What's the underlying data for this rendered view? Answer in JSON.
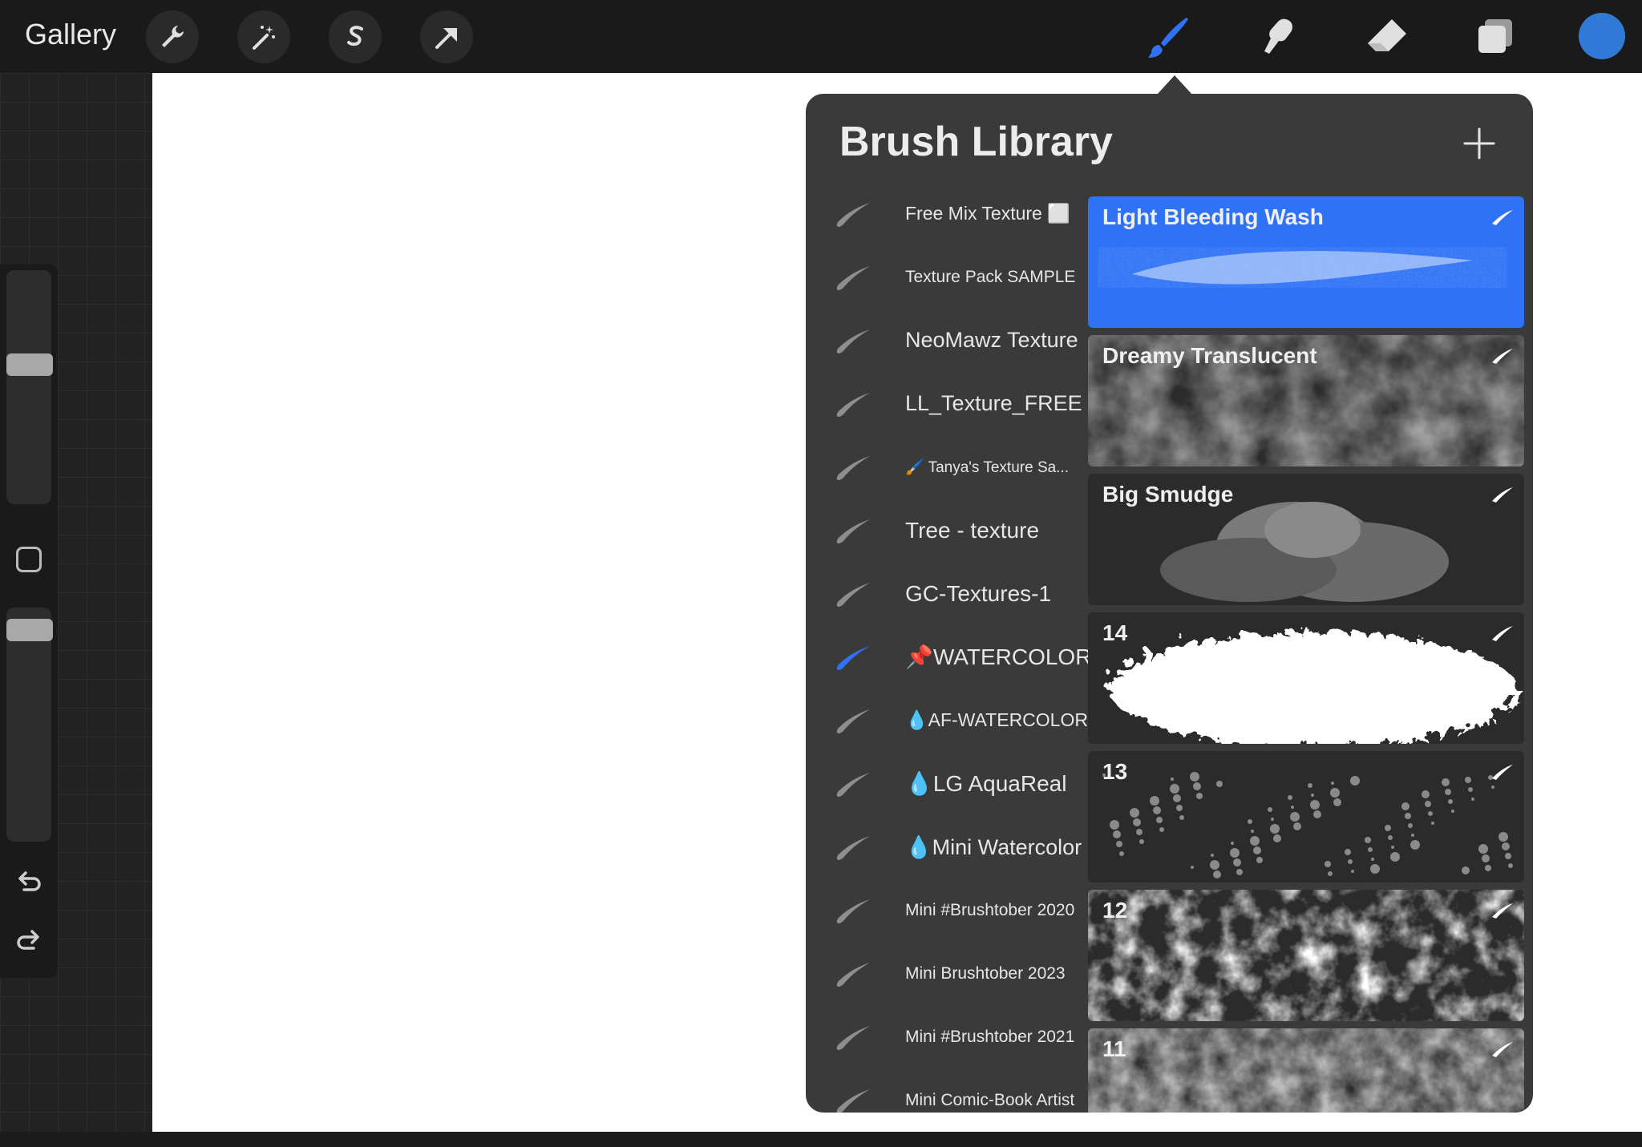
{
  "topbar": {
    "gallery_label": "Gallery",
    "left_tools": [
      "wrench-icon",
      "magic-wand-icon",
      "selection-s-icon",
      "transform-arrow-icon"
    ],
    "right_tools": [
      "brush-icon",
      "smudge-icon",
      "eraser-icon",
      "layers-icon"
    ],
    "active_tool": "brush-icon",
    "current_color": "#3079d6"
  },
  "brush_library": {
    "title": "Brush Library",
    "sets": [
      {
        "label": "Free Mix Texture ⬜",
        "active": false
      },
      {
        "label": "Texture Pack SAMPLE",
        "active": false
      },
      {
        "label": "NeoMawz Texture",
        "active": false
      },
      {
        "label": "LL_Texture_FREE",
        "active": false
      },
      {
        "label": "🖌️ Tanya's Texture Sa...",
        "active": false
      },
      {
        "label": "Tree - texture",
        "active": false
      },
      {
        "label": "GC-Textures-1",
        "active": false
      },
      {
        "label": "📌WATERCOLOR",
        "active": true
      },
      {
        "label": "💧AF-WATERCOLOR",
        "active": false
      },
      {
        "label": "💧LG AquaReal",
        "active": false
      },
      {
        "label": "💧Mini Watercolor",
        "active": false
      },
      {
        "label": "Mini #Brushtober 2020",
        "active": false
      },
      {
        "label": "Mini Brushtober 2023",
        "active": false
      },
      {
        "label": "Mini #Brushtober 2021",
        "active": false
      },
      {
        "label": "Mini Comic-Book Artist",
        "active": false
      }
    ],
    "brushes": [
      {
        "name": "Light Bleeding Wash",
        "selected": true
      },
      {
        "name": "Dreamy Translucent",
        "selected": false
      },
      {
        "name": "Big Smudge",
        "selected": false
      },
      {
        "name": "14",
        "selected": false
      },
      {
        "name": "13",
        "selected": false
      },
      {
        "name": "12",
        "selected": false
      },
      {
        "name": "11",
        "selected": false
      }
    ]
  },
  "colors": {
    "accent": "#2f72f5",
    "panel": "#3a3a3a"
  }
}
